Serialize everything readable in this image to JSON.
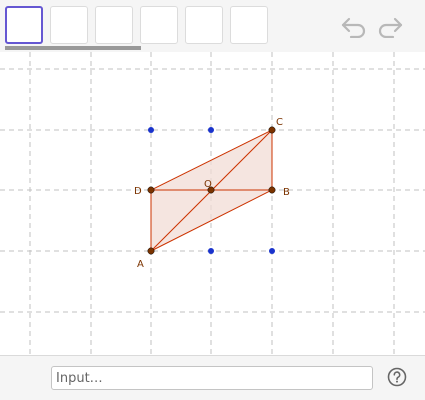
{
  "toolbar": {
    "tools": [
      {
        "name": "move-tool",
        "selected": true
      },
      {
        "name": "tool-2",
        "selected": false
      },
      {
        "name": "tool-3",
        "selected": false
      },
      {
        "name": "tool-4",
        "selected": false
      },
      {
        "name": "tool-5",
        "selected": false
      },
      {
        "name": "tool-6",
        "selected": false
      }
    ],
    "undo_icon": "undo-icon",
    "redo_icon": "redo-icon"
  },
  "graphics": {
    "points": {
      "A": "A",
      "B": "B",
      "C": "C",
      "D": "D",
      "O": "O"
    },
    "colors": {
      "grid": "#c0c0c0",
      "edge": "#cc3300",
      "fill": "#f2dcd6",
      "point": "#7b3300",
      "free_point": "#1a33cc"
    }
  },
  "input_bar": {
    "placeholder": "Input…",
    "help_icon": "help-icon"
  }
}
